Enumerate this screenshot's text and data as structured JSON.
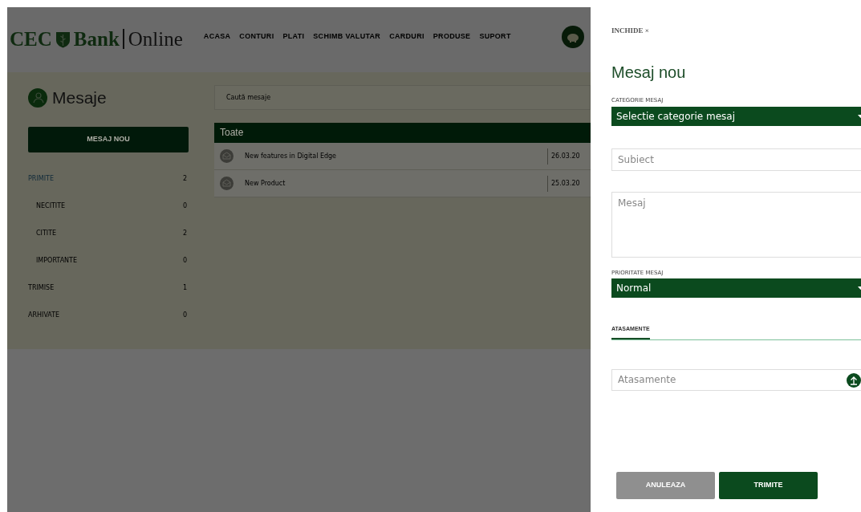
{
  "header": {
    "logo": {
      "left": "CEC",
      "middle": "Bank",
      "right": "Online"
    },
    "nav": [
      {
        "label": "ACASA"
      },
      {
        "label": "CONTURI"
      },
      {
        "label": "PLATI"
      },
      {
        "label": "SCHIMB VALUTAR"
      },
      {
        "label": "CARDURI"
      },
      {
        "label": "PRODUSE"
      },
      {
        "label": "SUPORT"
      }
    ]
  },
  "sidebar": {
    "title": "Mesaje",
    "new_button": "MESAJ NOU",
    "folders": [
      {
        "label": "PRIMITE",
        "count": "2",
        "selected": true,
        "children": [
          {
            "label": "NECITITE",
            "count": "0",
            "selected": false
          },
          {
            "label": "CITITE",
            "count": "2",
            "selected": false
          },
          {
            "label": "IMPORTANTE",
            "count": "0",
            "selected": false
          }
        ]
      },
      {
        "label": "TRIMISE",
        "count": "1",
        "selected": false
      },
      {
        "label": "ARHIVATE",
        "count": "0",
        "selected": false
      }
    ]
  },
  "messages": {
    "search": {
      "placeholder": "Caută mesaje"
    },
    "header": "Toate",
    "rows": [
      {
        "subject": "New features in Digital Edge",
        "date": "26.03.20"
      },
      {
        "subject": "New Product",
        "date": "25.03.20"
      }
    ]
  },
  "drawer": {
    "close": "INCHIDE ×",
    "title": "Mesaj nou",
    "category": {
      "label": "CATEGORIE MESAJ",
      "value": "Selectie categorie mesaj"
    },
    "subject": {
      "placeholder": "Subiect"
    },
    "message": {
      "placeholder": "Mesaj"
    },
    "priority": {
      "label": "PRIORITATE MESAJ",
      "value": "Normal"
    },
    "tabs": [
      {
        "label": "ATASAMENTE",
        "selected": true
      }
    ],
    "attachments": {
      "placeholder": "Atasamente"
    },
    "buttons": [
      {
        "label": "ANULEAZA",
        "kind": "secondary"
      },
      {
        "label": "TRIMITE",
        "kind": "primary"
      }
    ]
  }
}
